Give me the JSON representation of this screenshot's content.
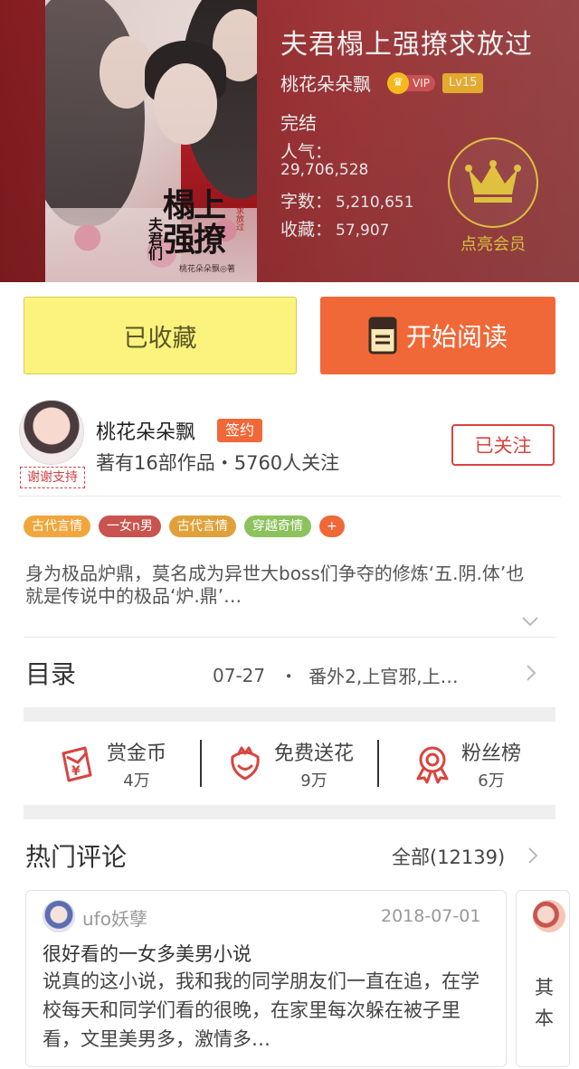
{
  "book": {
    "title": "夫君榻上强撩求放过",
    "author": "桃花朵朵飘",
    "vip_label": "VIP",
    "level": "Lv15",
    "status": "完结",
    "popularity_label": "人气：",
    "popularity_value": "29,706,528",
    "words_label": "字数：",
    "words_value": "5,210,651",
    "collect_label": "收藏：",
    "collect_value": "57,907",
    "member_label": "点亮会员"
  },
  "cover": {
    "title_big": "榻上强撩",
    "title_small": "夫君们",
    "author_line": "桃花朵朵飘◎著",
    "seal": "求放过"
  },
  "actions": {
    "collected_label": "已收藏",
    "read_label": "开始阅读"
  },
  "author_section": {
    "name": "桃花朵朵飘",
    "sign_badge": "签约",
    "sub": "著有16部作品・5760人关注",
    "follow_label": "已关注",
    "thanks_tag": "谢谢支持"
  },
  "tags": [
    {
      "label": "古代言情",
      "color": "#f0a63c"
    },
    {
      "label": "一女n男",
      "color": "#c9544f"
    },
    {
      "label": "古代言情",
      "color": "#e0a13a"
    },
    {
      "label": "穿越奇情",
      "color": "#8cc25b"
    },
    {
      "label": "+",
      "color": "#f06838"
    }
  ],
  "description": "身为极品炉鼎，莫名成为异世大boss们争夺的修炼‘五.阴.体’也就是传说中的极品‘炉.鼎’…",
  "toc": {
    "title": "目录",
    "latest_date": "07-27",
    "dot": "・",
    "latest_chapter": "番外2,上官邪,上…"
  },
  "stats": [
    {
      "label": "赏金币",
      "value": "4万",
      "icon": "red-envelope-icon"
    },
    {
      "label": "免费送花",
      "value": "9万",
      "icon": "flower-icon"
    },
    {
      "label": "粉丝榜",
      "value": "6万",
      "icon": "ribbon-medal-icon"
    }
  ],
  "comments": {
    "title": "热门评论",
    "all_label": "全部(12139)",
    "items": [
      {
        "user": "ufo妖孽",
        "date": "2018-07-01",
        "title": "很好看的一女多美男小说",
        "body": "说真的这小说，我和我的同学朋友们一直在追，在学校每天和同学们看的很晚，在家里每次躲在被子里看，文里美男多，激情多…"
      },
      {
        "body_partial": "其本"
      }
    ]
  },
  "colors": {
    "accent_orange": "#f06838",
    "collected_yellow": "#fbf37d",
    "follow_red": "#d9443f",
    "member_gold": "#f7d546"
  }
}
